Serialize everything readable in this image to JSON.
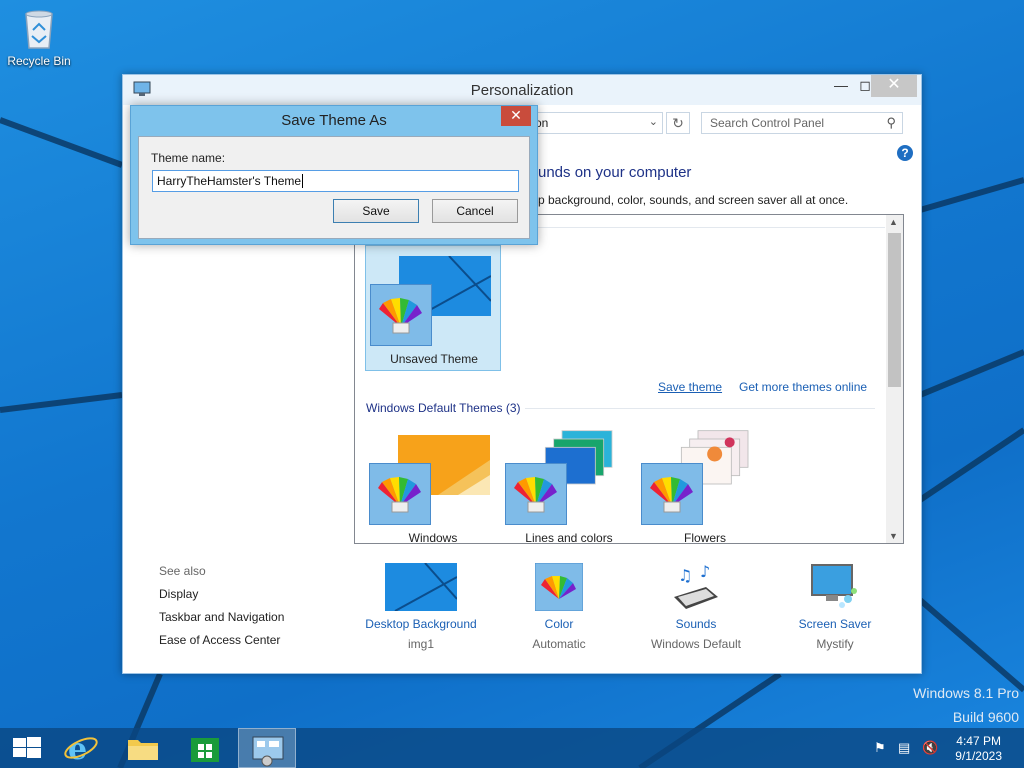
{
  "desktop": {
    "recycle_bin_label": "Recycle Bin",
    "watermark_line1": "Windows 8.1 Pro",
    "watermark_line2": "Build 9600"
  },
  "window": {
    "title": "Personalization",
    "address_text": "on",
    "search_placeholder": "Search Control Panel",
    "heading": "unds on your computer",
    "subheading": "p background, color, sounds, and screen saver all at once.",
    "my_themes": [
      {
        "label": "Unsaved Theme",
        "selected": true
      }
    ],
    "save_theme_link": "Save theme",
    "get_more_link": "Get more themes online",
    "default_group_label": "Windows Default Themes (3)",
    "default_themes": [
      {
        "label": "Windows"
      },
      {
        "label": "Lines and colors"
      },
      {
        "label": "Flowers"
      }
    ],
    "see_also": {
      "title": "See also",
      "items": [
        "Display",
        "Taskbar and Navigation",
        "Ease of Access Center"
      ]
    },
    "bottom_items": [
      {
        "title": "Desktop Background",
        "value": "img1",
        "icon": "desktop-background-icon"
      },
      {
        "title": "Color",
        "value": "Automatic",
        "icon": "color-palette-icon"
      },
      {
        "title": "Sounds",
        "value": "Windows Default",
        "icon": "sounds-icon"
      },
      {
        "title": "Screen Saver",
        "value": "Mystify",
        "icon": "screen-saver-icon"
      }
    ]
  },
  "dialog": {
    "title": "Save Theme As",
    "label": "Theme name:",
    "value": "HarryTheHamster's Theme",
    "save_label": "Save",
    "cancel_label": "Cancel"
  },
  "taskbar": {
    "time": "4:47 PM",
    "date": "9/1/2023",
    "apps": [
      "start",
      "internet-explorer",
      "file-explorer",
      "store",
      "control-panel"
    ],
    "active_app": "control-panel"
  },
  "colors": {
    "accent": "#1a5fb4",
    "dialog_frame": "#7ec3ec",
    "close_red": "#c94c3c",
    "desktop_blue": "#1277cf"
  }
}
